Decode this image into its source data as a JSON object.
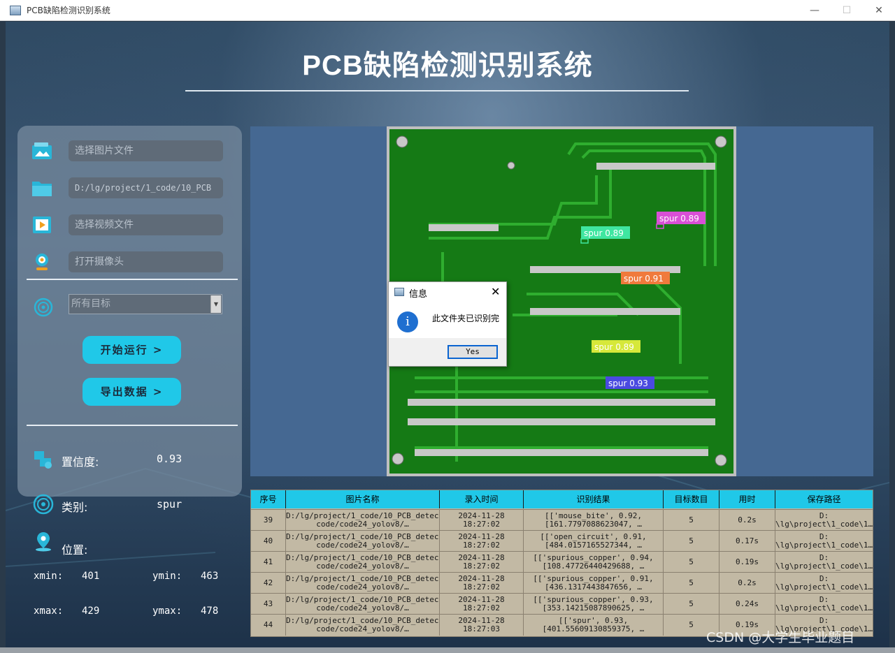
{
  "window": {
    "title": "PCB缺陷检测识别系统",
    "controls": [
      "—",
      "☐",
      "✕"
    ]
  },
  "main_title": "PCB缺陷检测识别系统",
  "left_panel": {
    "inputs": [
      {
        "icon": "image-file-icon",
        "placeholder": "选择图片文件"
      },
      {
        "icon": "folder-icon",
        "value": "D:/lg/project/1_code/10_PCB"
      },
      {
        "icon": "video-file-icon",
        "placeholder": "选择视频文件"
      },
      {
        "icon": "camera-icon",
        "placeholder": "打开摄像头"
      }
    ],
    "target_select": {
      "value": "所有目标"
    },
    "start_button": "开始运行 >",
    "export_button": "导出数据 >",
    "confidence_label": "置信度:",
    "confidence_value": "0.93",
    "class_label": "类别:",
    "class_value": "spur",
    "position_label": "位置:",
    "xmin_label": "xmin:",
    "xmin": "401",
    "ymin_label": "ymin:",
    "ymin": "463",
    "xmax_label": "xmax:",
    "xmax": "429",
    "ymax_label": "ymax:",
    "ymax": "478"
  },
  "detections": [
    {
      "label": "spur 0.89",
      "color": "#d94fd6"
    },
    {
      "label": "spur 0.89",
      "color": "#3fe6a0"
    },
    {
      "label": "spur 0.91",
      "color": "#f07a3c"
    },
    {
      "label": "spur 0.89",
      "color": "#d6e83a"
    },
    {
      "label": "spur 0.93",
      "color": "#4a4ae0"
    }
  ],
  "dialog": {
    "title": "信息",
    "message": "此文件夹已识别完",
    "ok_label": "Yes"
  },
  "table": {
    "headers": [
      "序号",
      "图片名称",
      "录入时间",
      "识别结果",
      "目标数目",
      "用时",
      "保存路径"
    ],
    "rows": [
      {
        "id": "39",
        "name1": "D:/lg/project/1_code/10_PCB_detect/",
        "name2": "code/code24_yolov8/…",
        "date": "2024-11-28",
        "time": "18:27:02",
        "res1": "[['mouse_bite', 0.92,",
        "res2": "[161.7797088623047, …",
        "count": "5",
        "dur": "0.2s",
        "path1": "D:",
        "path2": "\\lg\\project\\1_code\\1…"
      },
      {
        "id": "40",
        "name1": "D:/lg/project/1_code/10_PCB_detect/",
        "name2": "code/code24_yolov8/…",
        "date": "2024-11-28",
        "time": "18:27:02",
        "res1": "[['open_circuit', 0.91,",
        "res2": "[484.0157165527344, …",
        "count": "5",
        "dur": "0.17s",
        "path1": "D:",
        "path2": "\\lg\\project\\1_code\\1…"
      },
      {
        "id": "41",
        "name1": "D:/lg/project/1_code/10_PCB_detect/",
        "name2": "code/code24_yolov8/…",
        "date": "2024-11-28",
        "time": "18:27:02",
        "res1": "[['spurious_copper', 0.94,",
        "res2": "[108.47726440429688, …",
        "count": "5",
        "dur": "0.19s",
        "path1": "D:",
        "path2": "\\lg\\project\\1_code\\1…"
      },
      {
        "id": "42",
        "name1": "D:/lg/project/1_code/10_PCB_detect/",
        "name2": "code/code24_yolov8/…",
        "date": "2024-11-28",
        "time": "18:27:02",
        "res1": "[['spurious_copper', 0.91,",
        "res2": "[436.1317443847656, …",
        "count": "5",
        "dur": "0.2s",
        "path1": "D:",
        "path2": "\\lg\\project\\1_code\\1…"
      },
      {
        "id": "43",
        "name1": "D:/lg/project/1_code/10_PCB_detect/",
        "name2": "code/code24_yolov8/…",
        "date": "2024-11-28",
        "time": "18:27:02",
        "res1": "[['spurious_copper', 0.93,",
        "res2": "[353.14215087890625, …",
        "count": "5",
        "dur": "0.24s",
        "path1": "D:",
        "path2": "\\lg\\project\\1_code\\1…"
      },
      {
        "id": "44",
        "name1": "D:/lg/project/1_code/10_PCB_detect/",
        "name2": "code/code24_yolov8/…",
        "date": "2024-11-28",
        "time": "18:27:03",
        "res1": "[['spur', 0.93,",
        "res2": "[401.55609130859375, …",
        "count": "5",
        "dur": "0.19s",
        "path1": "D:",
        "path2": "\\lg\\project\\1_code\\1…"
      }
    ]
  },
  "watermark": "CSDN @大学生毕业题目",
  "colors": {
    "accent": "#20c8e8",
    "pcb_green": "#1a8a1a",
    "panel_bg": "#456892"
  }
}
